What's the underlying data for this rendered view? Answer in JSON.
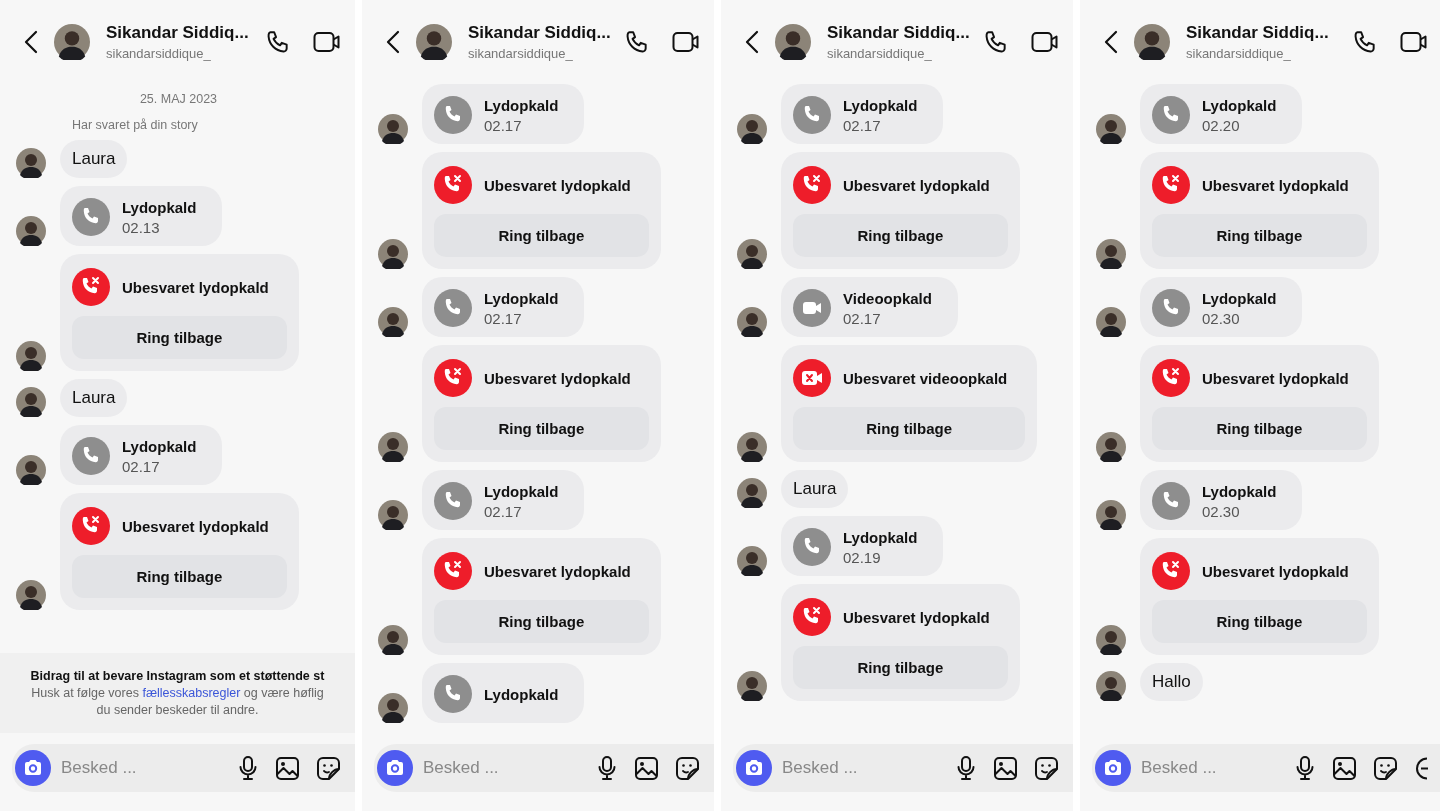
{
  "panels": [
    {
      "header": {
        "name": "Sikandar Siddiq...",
        "username": "sikandarsiddique_"
      },
      "messages": [
        {
          "kind": "date",
          "text": "25. MAJ 2023"
        },
        {
          "kind": "note",
          "text": "Har svaret på din story"
        },
        {
          "kind": "text",
          "text": "Laura"
        },
        {
          "kind": "audio_call",
          "title": "Lydopkald",
          "time": "02.13"
        },
        {
          "kind": "missed_audio_call",
          "title": "Ubesvaret lydopkald",
          "action": "Ring tilbage"
        },
        {
          "kind": "text",
          "text": "Laura"
        },
        {
          "kind": "audio_call",
          "title": "Lydopkald",
          "time": "02.17"
        },
        {
          "kind": "missed_audio_call",
          "title": "Ubesvaret lydopkald",
          "action": "Ring tilbage"
        }
      ],
      "notice": {
        "title": "Bidrag til at bevare Instagram som et støttende st",
        "body": "Husk at følge vores **fællesskabsregler** og være høflig",
        "body_end": "du sender beskeder til andre."
      },
      "composer": {
        "placeholder": "Besked ...",
        "more_button": false
      }
    },
    {
      "header": {
        "name": "Sikandar Siddiq...",
        "username": "sikandarsiddique_"
      },
      "messages": [
        {
          "kind": "audio_call",
          "title": "Lydopkald",
          "time": "02.17"
        },
        {
          "kind": "missed_audio_call",
          "title": "Ubesvaret lydopkald",
          "action": "Ring tilbage"
        },
        {
          "kind": "audio_call",
          "title": "Lydopkald",
          "time": "02.17"
        },
        {
          "kind": "missed_audio_call",
          "title": "Ubesvaret lydopkald",
          "action": "Ring tilbage"
        },
        {
          "kind": "audio_call",
          "title": "Lydopkald",
          "time": "02.17"
        },
        {
          "kind": "missed_audio_call",
          "title": "Ubesvaret lydopkald",
          "action": "Ring tilbage"
        },
        {
          "kind": "audio_call",
          "title": "Lydopkald"
        }
      ],
      "composer": {
        "placeholder": "Besked ...",
        "more_button": false
      }
    },
    {
      "header": {
        "name": "Sikandar Siddiq...",
        "username": "sikandarsiddique_"
      },
      "messages": [
        {
          "kind": "audio_call",
          "title": "Lydopkald",
          "time": "02.17"
        },
        {
          "kind": "missed_audio_call",
          "title": "Ubesvaret lydopkald",
          "action": "Ring tilbage"
        },
        {
          "kind": "video_call",
          "title": "Videoopkald",
          "time": "02.17"
        },
        {
          "kind": "missed_video_call",
          "title": "Ubesvaret videoopkald",
          "action": "Ring tilbage"
        },
        {
          "kind": "text",
          "text": "Laura"
        },
        {
          "kind": "audio_call",
          "title": "Lydopkald",
          "time": "02.19"
        },
        {
          "kind": "missed_audio_call",
          "title": "Ubesvaret lydopkald",
          "action": "Ring tilbage"
        }
      ],
      "composer": {
        "placeholder": "Besked ...",
        "more_button": false
      }
    },
    {
      "header": {
        "name": "Sikandar Siddiq...",
        "username": "sikandarsiddique_"
      },
      "messages": [
        {
          "kind": "audio_call",
          "title": "Lydopkald",
          "time": "02.20"
        },
        {
          "kind": "missed_audio_call",
          "title": "Ubesvaret lydopkald",
          "action": "Ring tilbage"
        },
        {
          "kind": "audio_call",
          "title": "Lydopkald",
          "time": "02.30"
        },
        {
          "kind": "missed_audio_call",
          "title": "Ubesvaret lydopkald",
          "action": "Ring tilbage"
        },
        {
          "kind": "audio_call",
          "title": "Lydopkald",
          "time": "02.30"
        },
        {
          "kind": "missed_audio_call",
          "title": "Ubesvaret lydopkald",
          "action": "Ring tilbage"
        },
        {
          "kind": "text",
          "text": "Hallo"
        }
      ],
      "composer": {
        "placeholder": "Besked ...",
        "more_button": true
      }
    }
  ]
}
